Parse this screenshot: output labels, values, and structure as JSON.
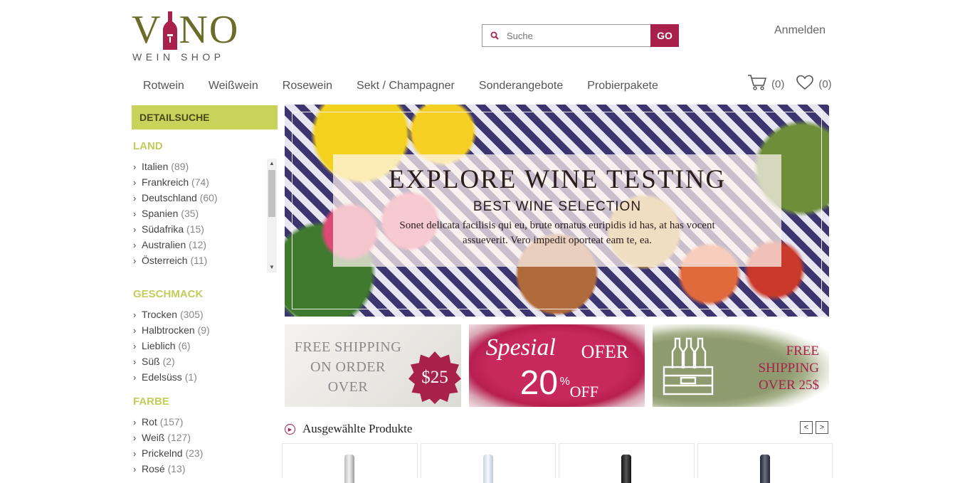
{
  "header": {
    "logo_word": "VINO",
    "logo_sub": "WEIN SHOP",
    "search_placeholder": "Suche",
    "search_button": "GO",
    "login": "Anmelden",
    "cart_count": "(0)",
    "wishlist_count": "(0)"
  },
  "nav": [
    "Rotwein",
    "Weißwein",
    "Rosewein",
    "Sekt / Champagner",
    "Sonderangebote",
    "Probierpakete"
  ],
  "sidebar": {
    "title": "DETAILSUCHE",
    "groups": [
      {
        "title": "LAND",
        "items": [
          {
            "label": "Italien",
            "count": "(89)"
          },
          {
            "label": "Frankreich",
            "count": "(74)"
          },
          {
            "label": "Deutschland",
            "count": "(60)"
          },
          {
            "label": "Spanien",
            "count": "(35)"
          },
          {
            "label": "Südafrika",
            "count": "(15)"
          },
          {
            "label": "Australien",
            "count": "(12)"
          },
          {
            "label": "Österreich",
            "count": "(11)"
          }
        ]
      },
      {
        "title": "GESCHMACK",
        "items": [
          {
            "label": "Trocken",
            "count": "(305)"
          },
          {
            "label": "Halbtrocken",
            "count": "(9)"
          },
          {
            "label": "Lieblich",
            "count": "(6)"
          },
          {
            "label": "Süß",
            "count": "(2)"
          },
          {
            "label": "Edelsüss",
            "count": "(1)"
          }
        ]
      },
      {
        "title": "FARBE",
        "items": [
          {
            "label": "Rot",
            "count": "(157)"
          },
          {
            "label": "Weiß",
            "count": "(127)"
          },
          {
            "label": "Prickelnd",
            "count": "(23)"
          },
          {
            "label": "Rosé",
            "count": "(13)"
          }
        ]
      }
    ]
  },
  "hero": {
    "title": "EXPLORE WINE TESTING",
    "subtitle": "BEST WINE SELECTION",
    "text": "Sonet delicata facilisis qui eu, brute ornatus euripidis id has, at has vocent assueverit. Vero impedit oporteat eam te, ea."
  },
  "banners": {
    "b1_line1": "FREE SHIPPING",
    "b1_line2": "ON ORDER",
    "b1_line3": "OVER",
    "b1_price": "$25",
    "b2_script": "Spesial",
    "b2_ofer": "OFER",
    "b2_num": "20",
    "b2_pct": "%",
    "b2_off": "OFF",
    "b3_line1": "FREE",
    "b3_line2": "SHIPPING",
    "b3_line3": "OVER 25$"
  },
  "featured": {
    "title": "Ausgewählte Produkte",
    "prev": "<",
    "next": ">"
  },
  "colors": {
    "accent": "#a8214b",
    "olive": "#6b6b2a",
    "lime": "#c7d35b"
  }
}
